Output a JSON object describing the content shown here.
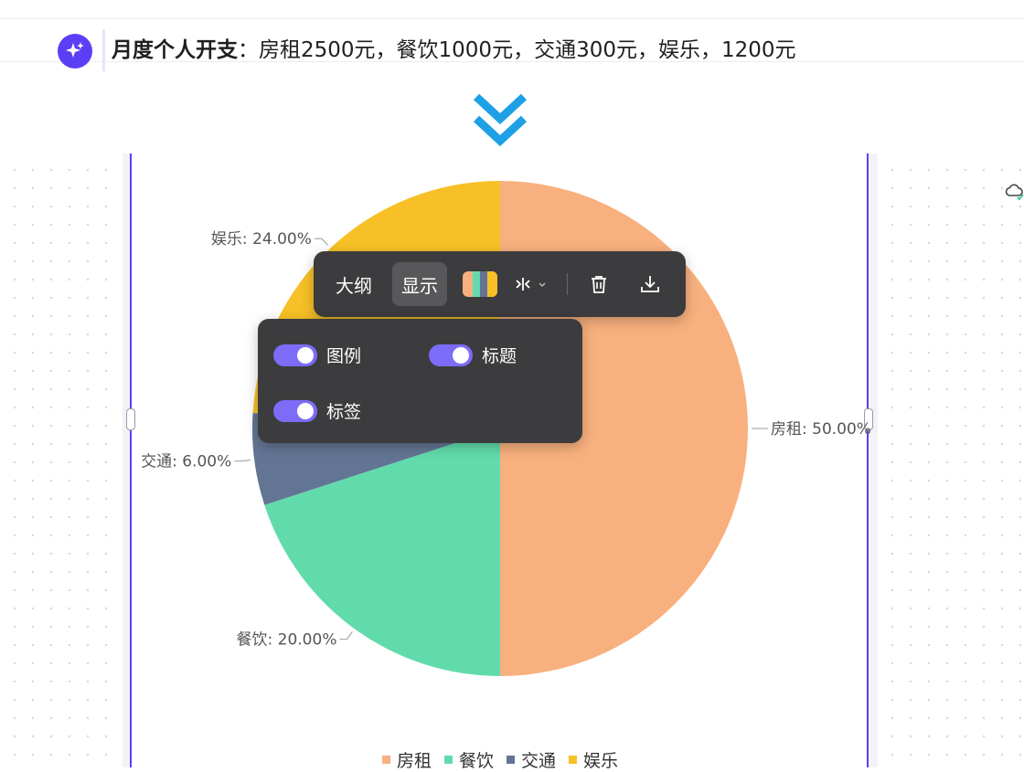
{
  "prompt": {
    "bold_label": "月度个人开支",
    "separator": "：",
    "text": "房租2500元，餐饮1000元，交通300元，娱乐，1200元"
  },
  "toolbar": {
    "outline_label": "大纲",
    "display_label": "显示",
    "delete_icon": "trash-icon",
    "download_icon": "download-icon",
    "layout_icon": "split-layout-icon",
    "palette_icon": "color-palette-icon"
  },
  "display_options": {
    "legend_label": "图例",
    "legend_on": true,
    "title_label": "标题",
    "title_on": true,
    "labels_label": "标签",
    "labels_on": true
  },
  "colors": {
    "accent": "#5b3ff5",
    "toggle": "#7c6cf8",
    "arrow": "#1ea0e6"
  },
  "chart_data": {
    "type": "pie",
    "categories": [
      "房租",
      "餐饮",
      "交通",
      "娱乐"
    ],
    "values": [
      2500,
      1000,
      300,
      1200
    ],
    "labels": [
      "房租: 50.00%",
      "餐饮: 20.00%",
      "交通: 6.00%",
      "娱乐: 24.00%"
    ],
    "colors": [
      "#f8b07e",
      "#62dbac",
      "#637594",
      "#f6c026"
    ],
    "legend": {
      "position": "bottom",
      "entries": [
        "房租",
        "餐饮",
        "交通",
        "娱乐"
      ]
    }
  }
}
